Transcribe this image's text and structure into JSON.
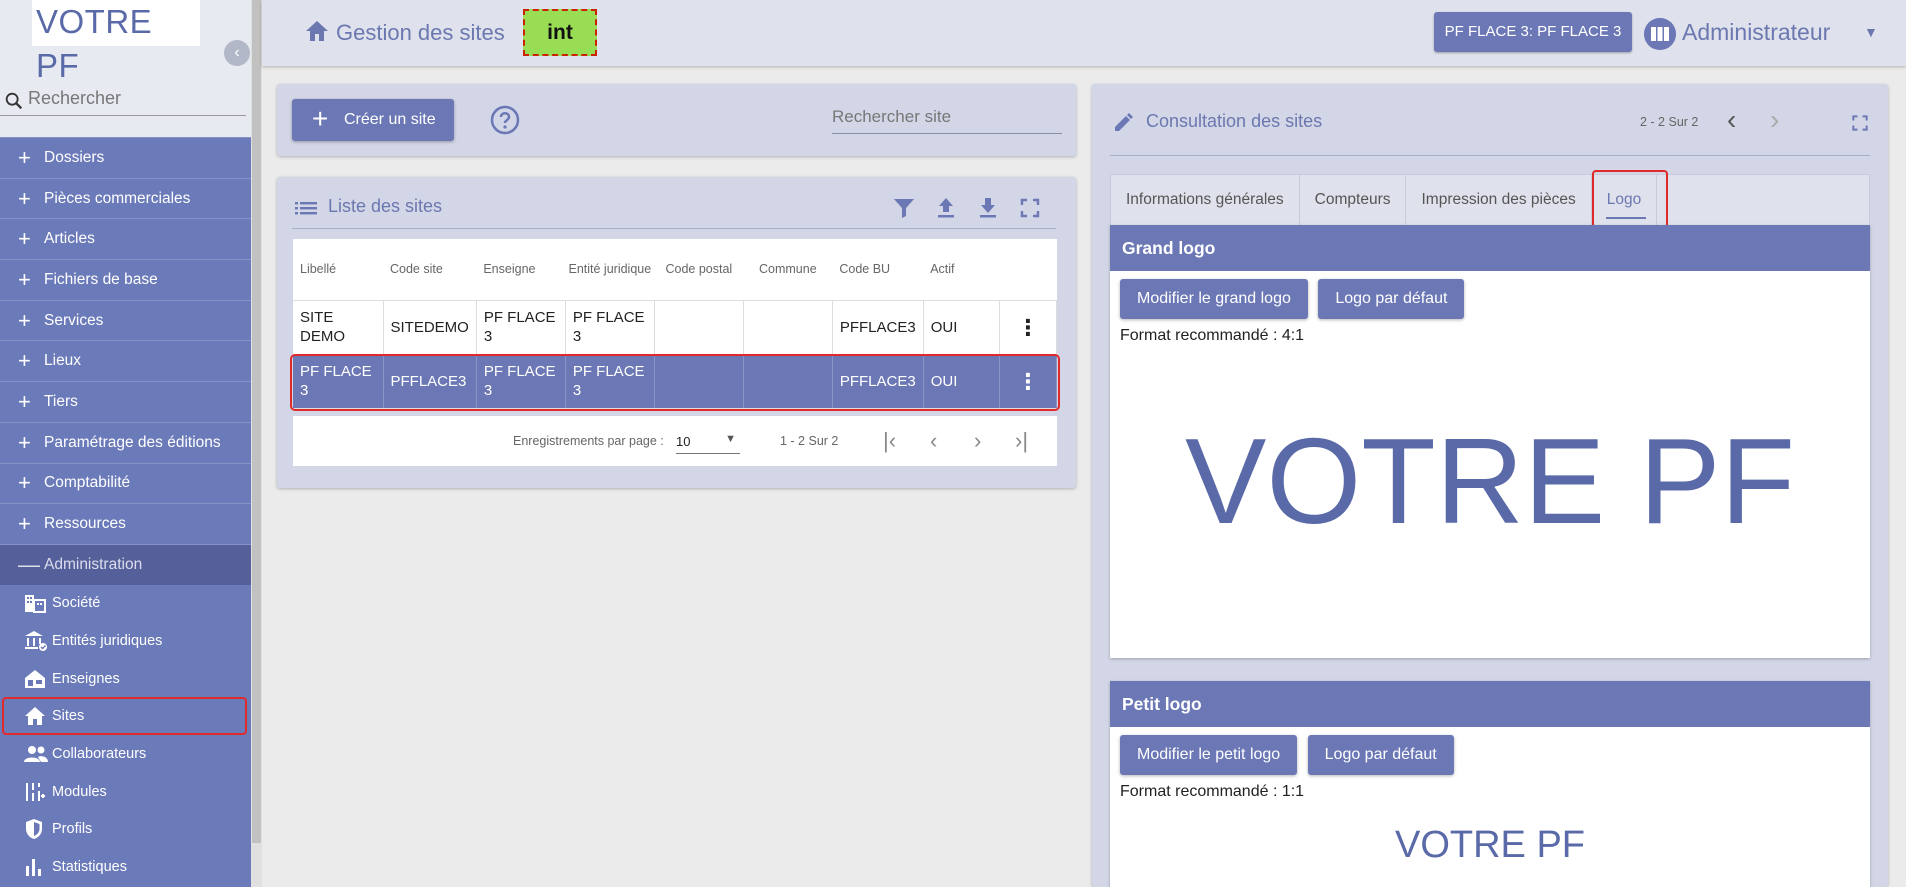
{
  "sidebar": {
    "logo_text": "VOTRE PF",
    "search_placeholder": "Rechercher",
    "items": [
      {
        "label": "Dossiers"
      },
      {
        "label": "Pièces commerciales"
      },
      {
        "label": "Articles"
      },
      {
        "label": "Fichiers de base"
      },
      {
        "label": "Services"
      },
      {
        "label": "Lieux"
      },
      {
        "label": "Tiers"
      },
      {
        "label": "Paramétrage des éditions"
      },
      {
        "label": "Comptabilité"
      },
      {
        "label": "Ressources"
      }
    ],
    "admin": {
      "label": "Administration",
      "sub_items": [
        {
          "label": "Société",
          "icon": "building-icon"
        },
        {
          "label": "Entités juridiques",
          "icon": "bank-icon"
        },
        {
          "label": "Enseignes",
          "icon": "store-icon"
        },
        {
          "label": "Sites",
          "icon": "home-icon"
        },
        {
          "label": "Collaborateurs",
          "icon": "people-icon"
        },
        {
          "label": "Modules",
          "icon": "modules-icon"
        },
        {
          "label": "Profils",
          "icon": "shield-icon"
        },
        {
          "label": "Statistiques",
          "icon": "bar-chart-icon"
        }
      ]
    }
  },
  "header": {
    "title": "Gestion des sites",
    "env_badge": "int",
    "context_button": "PF FLACE 3: PF FLACE 3",
    "user_name": "Administrateur"
  },
  "actions": {
    "create_label": "Créer un site",
    "site_search_placeholder": "Rechercher site"
  },
  "list": {
    "title": "Liste des sites",
    "columns": [
      "Libellé",
      "Code site",
      "Enseigne",
      "Entité juridique",
      "Code postal",
      "Commune",
      "Code BU",
      "Actif"
    ],
    "rows": [
      {
        "libelle": "SITE DEMO",
        "code_site": "SITEDEMO",
        "enseigne": "PF FLACE 3",
        "entite": "PF FLACE 3",
        "code_postal": "",
        "commune": "",
        "code_bu": "PFFLACE3",
        "actif": "OUI"
      },
      {
        "libelle": "PF FLACE 3",
        "code_site": "PFFLACE3",
        "enseigne": "PF FLACE 3",
        "entite": "PF FLACE 3",
        "code_postal": "",
        "commune": "",
        "code_bu": "PFFLACE3",
        "actif": "OUI"
      }
    ],
    "pager": {
      "per_page_label": "Enregistrements par page :",
      "per_page_value": "10",
      "range": "1 - 2 Sur 2"
    }
  },
  "detail": {
    "title": "Consultation des sites",
    "pages": "2 - 2 Sur 2",
    "tabs": [
      "Informations générales",
      "Compteurs",
      "Impression des pièces",
      "Logo"
    ],
    "active_tab": "Logo",
    "grand_logo": {
      "title": "Grand logo",
      "modify_label": "Modifier le grand logo",
      "default_label": "Logo par défaut",
      "format": "Format recommandé : 4:1",
      "preview_text": "VOTRE PF"
    },
    "petit_logo": {
      "title": "Petit logo",
      "modify_label": "Modifier le petit logo",
      "default_label": "Logo par défaut",
      "format": "Format recommandé : 1:1",
      "preview_text": "VOTRE PF"
    }
  },
  "colors": {
    "primary": "#6b78b5",
    "sidebar_bg": "#6b78b8",
    "panel_bg": "#d2d6e6",
    "highlight_red": "#e02a2a",
    "env_badge": "#99dd55"
  }
}
